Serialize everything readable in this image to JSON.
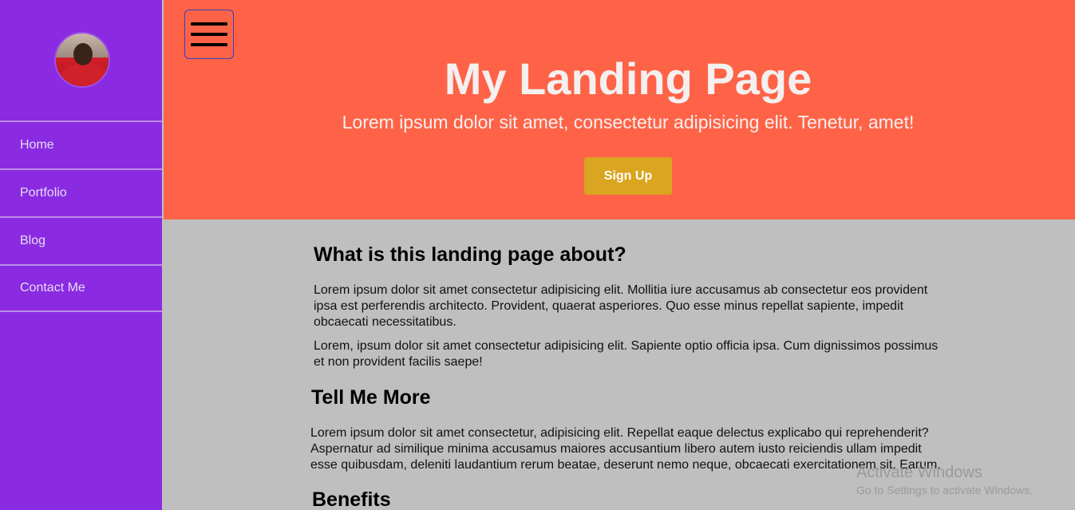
{
  "sidebar": {
    "avatar_alt": "Profile photo",
    "nav": [
      "Home",
      "Portfolio",
      "Blog",
      "Contact Me"
    ]
  },
  "hero": {
    "title": "My Landing Page",
    "subtitle": "Lorem ipsum dolor sit amet, consectetur adipisicing elit. Tenetur, amet!",
    "cta": "Sign Up"
  },
  "content": {
    "about_heading": "What is this landing page about?",
    "about_p1": "Lorem ipsum dolor sit amet consectetur adipisicing elit. Mollitia iure accusamus ab consectetur eos provident ipsa est perferendis architecto. Provident, quaerat asperiores. Quo esse minus repellat sapiente, impedit obcaecati necessitatibus.",
    "about_p2": "Lorem, ipsum dolor sit amet consectetur adipisicing elit. Sapiente optio officia ipsa. Cum dignissimos possimus et non provident facilis saepe!",
    "more_heading": "Tell Me More",
    "more_p1": "Lorem ipsum dolor sit amet consectetur, adipisicing elit. Repellat eaque delectus explicabo qui reprehenderit? Aspernatur ad similique minima accusamus maiores accusantium libero autem iusto reiciendis ullam impedit esse quibusdam, deleniti laudantium rerum beatae, deserunt nemo neque, obcaecati exercitationem sit. Earum.",
    "benefits_heading": "Benefits"
  },
  "watermark": {
    "line1": "Activate Windows",
    "line2": "Go to Settings to activate Windows."
  },
  "colors": {
    "sidebar": "#8a2be2",
    "hero": "#ff6347",
    "button": "#daa520",
    "content_bg": "#bfbfbf"
  }
}
